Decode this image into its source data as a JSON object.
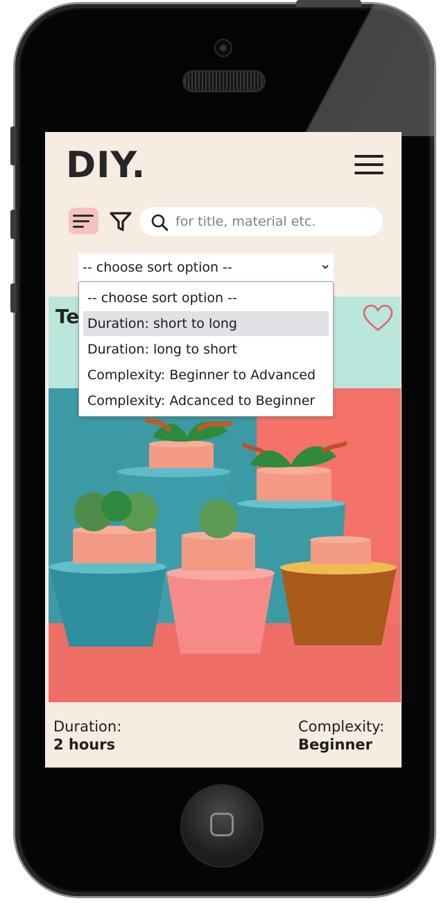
{
  "app": {
    "logo_text": "DIY."
  },
  "toolbar": {
    "sort_icon": "sort-lines-icon",
    "filter_icon": "filter-funnel-icon",
    "search_icon": "magnifier-icon",
    "search_placeholder": "for title, material etc.",
    "search_value": ""
  },
  "sort": {
    "selected_label": "-- choose sort option --",
    "highlighted_index": 1,
    "options": [
      "-- choose sort option --",
      "Duration: short to long",
      "Duration: long to short",
      "Complexity: Beginner to Advanced",
      "Complexity: Adcanced to Beginner"
    ]
  },
  "card": {
    "title_visible": "Te",
    "favorite_icon": "heart-outline-icon",
    "image_subject": "potted plants on pastel pedestals",
    "duration_label": "Duration:",
    "duration_value": "2 hours",
    "complexity_label": "Complexity:",
    "complexity_value": "Beginner"
  },
  "colors": {
    "screen_bg": "#f7ece2",
    "card_header_bg": "#b9e7dc",
    "sort_button_bg": "#f6c2bd",
    "heart": "#e8606a",
    "highlight": "#e2e1e7"
  }
}
